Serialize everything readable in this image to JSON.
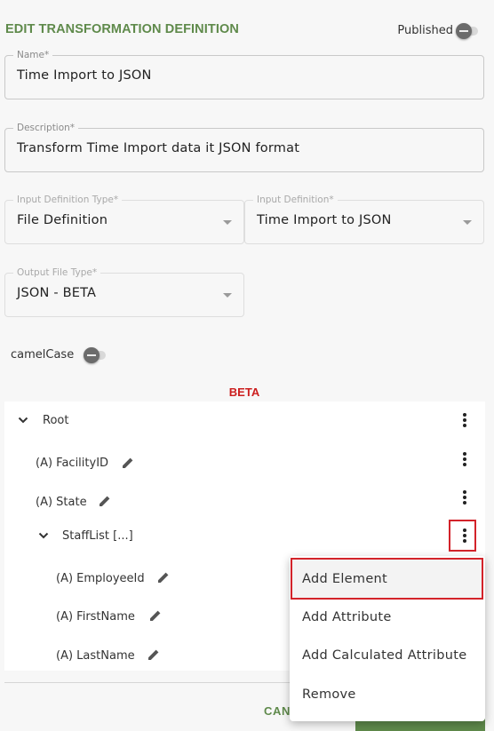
{
  "header": {
    "title": "EDIT TRANSFORMATION DEFINITION",
    "published_label": "Published"
  },
  "form": {
    "name": {
      "label": "Name*",
      "value": "Time Import to JSON"
    },
    "description": {
      "label": "Description*",
      "value": "Transform Time Import data it JSON format"
    },
    "input_type": {
      "label": "Input Definition Type*",
      "value": "File Definition"
    },
    "input_definition": {
      "label": "Input Definition*",
      "value": "Time Import to JSON"
    },
    "output_type": {
      "label": "Output File Type*",
      "value": "JSON - BETA"
    },
    "camel_case_label": "camelCase"
  },
  "beta_label": "BETA",
  "tree": {
    "root": "Root",
    "facility": "(A) FacilityID",
    "state": "(A) State",
    "stafflist": "StaffList [...]",
    "employee": "(A) EmployeeId",
    "firstname": "(A) FirstName",
    "lastname": "(A) LastName"
  },
  "menu": {
    "items": [
      "Add Element",
      "Add Attribute",
      "Add Calculated Attribute",
      "Remove"
    ]
  },
  "footer": {
    "cancel_label": "CAN"
  },
  "colors": {
    "accent": "#5f8a4b",
    "highlight": "#d3232a",
    "beta": "#cc1e1e"
  }
}
